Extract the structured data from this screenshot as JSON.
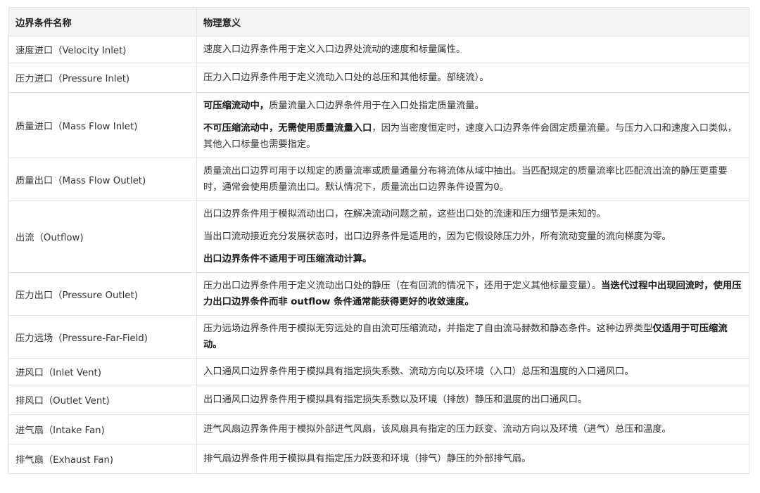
{
  "table": {
    "headers": [
      "边界条件名称",
      "物理意义"
    ],
    "rows": [
      {
        "name": "速度进口（Velocity Inlet)",
        "paragraphs": [
          [
            {
              "t": "速度入口边界条件用于定义入口边界处流动的速度和标量属性。"
            }
          ]
        ]
      },
      {
        "name": "压力进口（Pressure Inlet)",
        "paragraphs": [
          [
            {
              "t": "压力入口边界条件用于定义流动入口处的总压和其他标量。部绕流）。"
            }
          ]
        ]
      },
      {
        "name": "质量进口（Mass Flow Inlet)",
        "paragraphs": [
          [
            {
              "t": "可压缩流动中，",
              "b": true
            },
            {
              "t": "质量流量入口边界条件用于在入口处指定质量流量。"
            }
          ],
          [
            {
              "t": "不可压缩流动中，无需使用质量流量入口",
              "b": true
            },
            {
              "t": "，因为当密度恒定时，速度入口边界条件会固定质量流量。与压力入口和速度入口类似，其他入口标量也需要指定。"
            }
          ]
        ]
      },
      {
        "name": "质量出口（Mass Flow Outlet)",
        "paragraphs": [
          [
            {
              "t": "质量流出口边界可用于以规定的质量流率或质量通量分布将流体从域中抽出。当匹配规定的质量流率比匹配流出流的静压更重要时，通常会使用质量流出口。默认情况下，质量流出口边界条件设置为0。"
            }
          ]
        ]
      },
      {
        "name": "出流（Outflow)",
        "paragraphs": [
          [
            {
              "t": "出口边界条件用于模拟流动出口，在解决流动问题之前，这些出口处的流速和压力细节是未知的。"
            }
          ],
          [
            {
              "t": "当出口流动接近充分发展状态时，出口边界条件是适用的，因为它假设除压力外，所有流动变量的流向梯度为零。"
            }
          ],
          [
            {
              "t": "出口边界条件不适用于可压缩流动计算。",
              "b": true
            }
          ]
        ]
      },
      {
        "name": "压力出口（Pressure Outlet)",
        "paragraphs": [
          [
            {
              "t": "压力出口边界条件用于定义流动出口处的静压（在有回流的情况下，还用于定义其他标量变量）。"
            },
            {
              "t": "当迭代过程中出现回流时，使用压力出口边界条件而非 outflow 条件通常能获得更好的收敛速度。",
              "b": true
            }
          ]
        ]
      },
      {
        "name": "压力远场（Pressure-Far-Field)",
        "paragraphs": [
          [
            {
              "t": "压力远场边界条件用于模拟无穷远处的自由流可压缩流动，并指定了自由流马赫数和静态条件。这种边界类型"
            },
            {
              "t": "仅适用于可压缩流动。",
              "b": true
            }
          ]
        ]
      },
      {
        "name": "进风口（Inlet Vent)",
        "paragraphs": [
          [
            {
              "t": "入口通风口边界条件用于模拟具有指定损失系数、流动方向以及环境（入口）总压和温度的入口通风口。"
            }
          ]
        ]
      },
      {
        "name": "排风口（Outlet Vent)",
        "paragraphs": [
          [
            {
              "t": "出口通风口边界条件用于模拟具有指定损失系数以及环境（排放）静压和温度的出口通风口。"
            }
          ]
        ]
      },
      {
        "name": "进气扇（Intake Fan)",
        "paragraphs": [
          [
            {
              "t": "进气风扇边界条件用于模拟外部进气风扇，该风扇具有指定的压力跃变、流动方向以及环境（进气）总压和温度。"
            }
          ]
        ]
      },
      {
        "name": "排气扇（Exhaust Fan)",
        "paragraphs": [
          [
            {
              "t": "排气扇边界条件用于模拟具有指定压力跃变和环境（排气）静压的外部排气扇。"
            }
          ]
        ]
      }
    ]
  }
}
